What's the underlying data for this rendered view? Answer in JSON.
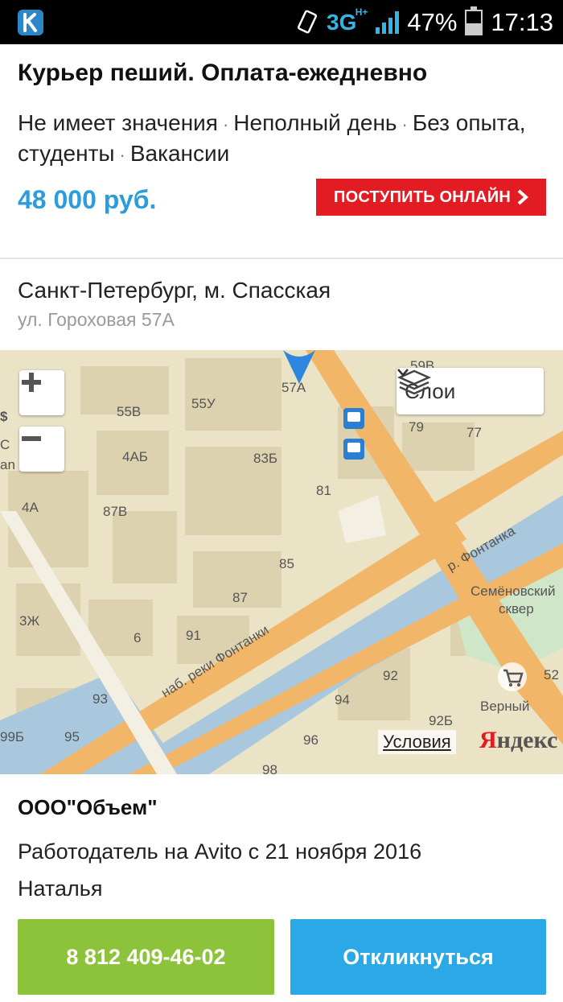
{
  "status_bar": {
    "network": "3G",
    "network_sub": "H+",
    "battery": "47%",
    "battery_level": 0.47,
    "time": "17:13",
    "app_icon": "k-app-icon"
  },
  "job": {
    "title": "Курьер пеший. Оплата-ежедневно",
    "tags": [
      "Не имеет значения",
      "Неполный день",
      "Без опыта, студенты",
      "Вакансии"
    ],
    "salary": "48 000 руб.",
    "apply_label": "ПОСТУПИТЬ ОНЛАЙН"
  },
  "address": {
    "city": "Санкт-Петербург, м. Спасская",
    "street": "ул. Гороховая 57А"
  },
  "map": {
    "layers_label": "Слои",
    "terms_label": "Условия",
    "brand_label_first": "Я",
    "brand_label_rest": "ндекс",
    "street_label": "наб. реки Фонтанки",
    "river_label": "р. Фонтанка",
    "park_label_1": "Семёновский",
    "park_label_2": "сквер",
    "store_label": "Верный",
    "building_labels": [
      "57А",
      "59В",
      "55В",
      "55У",
      "79",
      "77",
      "4АБ",
      "83Б",
      "81",
      "4А",
      "87В",
      "85",
      "87",
      "3Ж",
      "6",
      "91",
      "93",
      "92",
      "52",
      "94",
      "92Б",
      "99Б",
      "95",
      "96",
      "98",
      "С",
      "$",
      "an"
    ]
  },
  "company": {
    "name": "ООО\"Объем\"",
    "since": "Работодатель на Avito с 21 ноября 2016",
    "contact": "Наталья"
  },
  "actions": {
    "phone": "8 812 409-46-02",
    "respond": "Откликнуться"
  }
}
